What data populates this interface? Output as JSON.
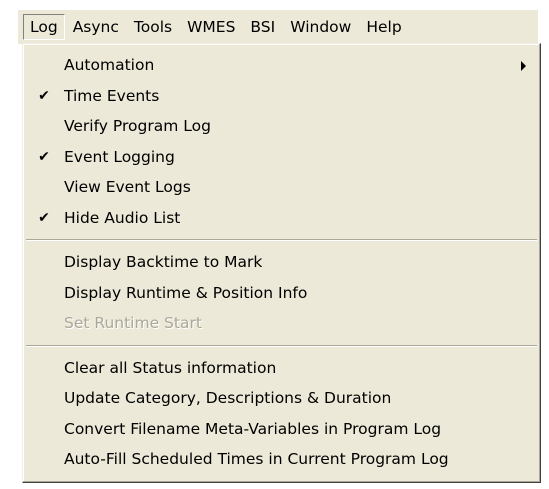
{
  "menubar": {
    "items": [
      {
        "label": "Log"
      },
      {
        "label": "Async"
      },
      {
        "label": "Tools"
      },
      {
        "label": "WMES"
      },
      {
        "label": "BSI"
      },
      {
        "label": "Window"
      },
      {
        "label": "Help"
      }
    ]
  },
  "log_menu": {
    "check_glyph": "✔",
    "groups": [
      {
        "items": [
          {
            "label": "Automation",
            "checked": false,
            "submenu": true,
            "enabled": true
          },
          {
            "label": "Time Events",
            "checked": true,
            "submenu": false,
            "enabled": true
          },
          {
            "label": "Verify Program Log",
            "checked": false,
            "submenu": false,
            "enabled": true
          },
          {
            "label": "Event Logging",
            "checked": true,
            "submenu": false,
            "enabled": true
          },
          {
            "label": "View Event Logs",
            "checked": false,
            "submenu": false,
            "enabled": true
          },
          {
            "label": "Hide Audio List",
            "checked": true,
            "submenu": false,
            "enabled": true
          }
        ]
      },
      {
        "items": [
          {
            "label": "Display Backtime to Mark",
            "checked": false,
            "submenu": false,
            "enabled": true
          },
          {
            "label": "Display Runtime & Position Info",
            "checked": false,
            "submenu": false,
            "enabled": true
          },
          {
            "label": "Set Runtime Start",
            "checked": false,
            "submenu": false,
            "enabled": false
          }
        ]
      },
      {
        "items": [
          {
            "label": "Clear all Status information",
            "checked": false,
            "submenu": false,
            "enabled": true
          },
          {
            "label": "Update Category, Descriptions & Duration",
            "checked": false,
            "submenu": false,
            "enabled": true
          },
          {
            "label": "Convert Filename Meta-Variables in Program Log",
            "checked": false,
            "submenu": false,
            "enabled": true
          },
          {
            "label": "Auto-Fill Scheduled Times in Current Program Log",
            "checked": false,
            "submenu": false,
            "enabled": true
          }
        ]
      }
    ]
  }
}
